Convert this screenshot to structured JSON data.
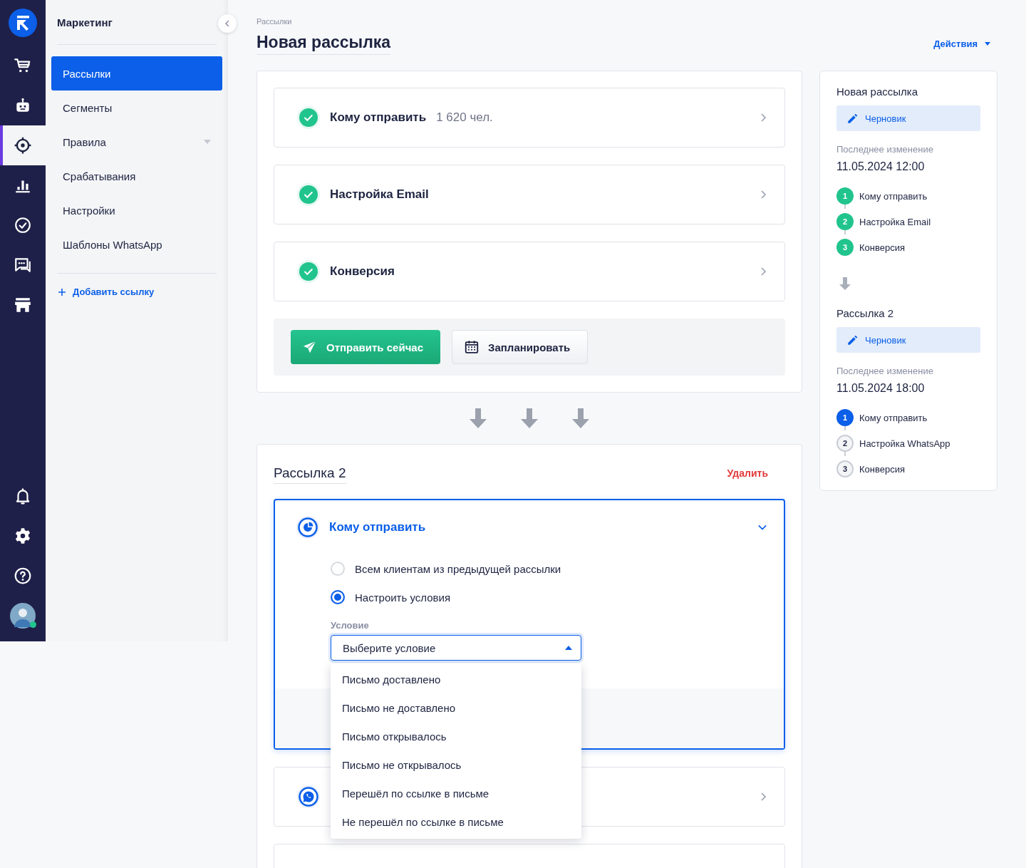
{
  "rail": {
    "top": [
      {
        "kind": "cart",
        "selected": false
      },
      {
        "kind": "robot",
        "selected": false
      },
      {
        "kind": "target",
        "selected": true
      },
      {
        "kind": "chart",
        "selected": false
      },
      {
        "kind": "check",
        "selected": false
      },
      {
        "kind": "chat",
        "selected": false
      },
      {
        "kind": "store",
        "selected": false
      }
    ],
    "bottom": [
      {
        "kind": "bell",
        "selected": false
      },
      {
        "kind": "gear",
        "selected": false
      },
      {
        "kind": "help",
        "selected": false
      }
    ],
    "user": {
      "online": true
    }
  },
  "sidebar": {
    "title": "Маркетинг",
    "items": [
      {
        "label": "Рассылки",
        "selected": true,
        "submenu": false
      },
      {
        "label": "Сегменты",
        "selected": false,
        "submenu": false
      },
      {
        "label": "Правила",
        "selected": false,
        "submenu": true
      },
      {
        "label": "Срабатывания",
        "selected": false,
        "submenu": false
      },
      {
        "label": "Настройки",
        "selected": false,
        "submenu": false
      },
      {
        "label": "Шаблоны WhatsApp",
        "selected": false,
        "submenu": false
      }
    ],
    "add_link": "Добавить ссылку"
  },
  "breadcrumb": "Рассылки",
  "title": "Новая рассылка",
  "actions": "Действия",
  "mailing": {
    "steps": [
      {
        "title": "Кому отправить",
        "detail": "1 620 чел.",
        "done": true
      },
      {
        "title": "Настройка Email",
        "done": true
      },
      {
        "title": "Конверсия",
        "done": true
      }
    ],
    "buttons": [
      {
        "label": "Отправить сейчас",
        "kind": "send"
      },
      {
        "label": "Запланировать",
        "kind": "schedule"
      }
    ]
  },
  "mailing_2": {
    "title": "Рассылка 2",
    "delete": "Удалить",
    "active_step": {
      "title": "Кому отправить",
      "expanded": true,
      "options": [
        {
          "label": "Всем клиентам из предыдущей рассылки",
          "selected": false
        },
        {
          "label": "Настроить условия",
          "selected": true
        }
      ],
      "condition": {
        "label": "Условие",
        "placeholder": "Выберите условие",
        "open": true,
        "options": [
          "Письмо доставлено",
          "Письмо не доставлено",
          "Письмо открывалось",
          "Письмо не открывалось",
          "Перешёл по ссылке в письме",
          "Не перешёл по ссылке в письме"
        ]
      }
    },
    "other_steps": [
      {
        "kind": "whatsapp"
      },
      {
        "kind": "partial"
      }
    ]
  },
  "summary": [
    {
      "title": "Новая рассылка",
      "status": "Черновик",
      "changed_label": "Последнее изменение",
      "changed_at": "11.05.2024 12:00",
      "steps": [
        {
          "number": "1",
          "label": "Кому отправить",
          "done": true,
          "current": false
        },
        {
          "number": "2",
          "label": "Настройка Email",
          "done": true,
          "current": false
        },
        {
          "number": "3",
          "label": "Конверсия",
          "done": true,
          "current": false
        }
      ]
    },
    {
      "title": "Рассылка 2",
      "status": "Черновик",
      "changed_label": "Последнее изменение",
      "changed_at": "11.05.2024 18:00",
      "steps": [
        {
          "number": "1",
          "label": "Кому отправить",
          "done": false,
          "current": true
        },
        {
          "number": "2",
          "label": "Настройка WhatsApp",
          "done": false,
          "current": false
        },
        {
          "number": "3",
          "label": "Конверсия",
          "done": false,
          "current": false
        }
      ]
    }
  ]
}
